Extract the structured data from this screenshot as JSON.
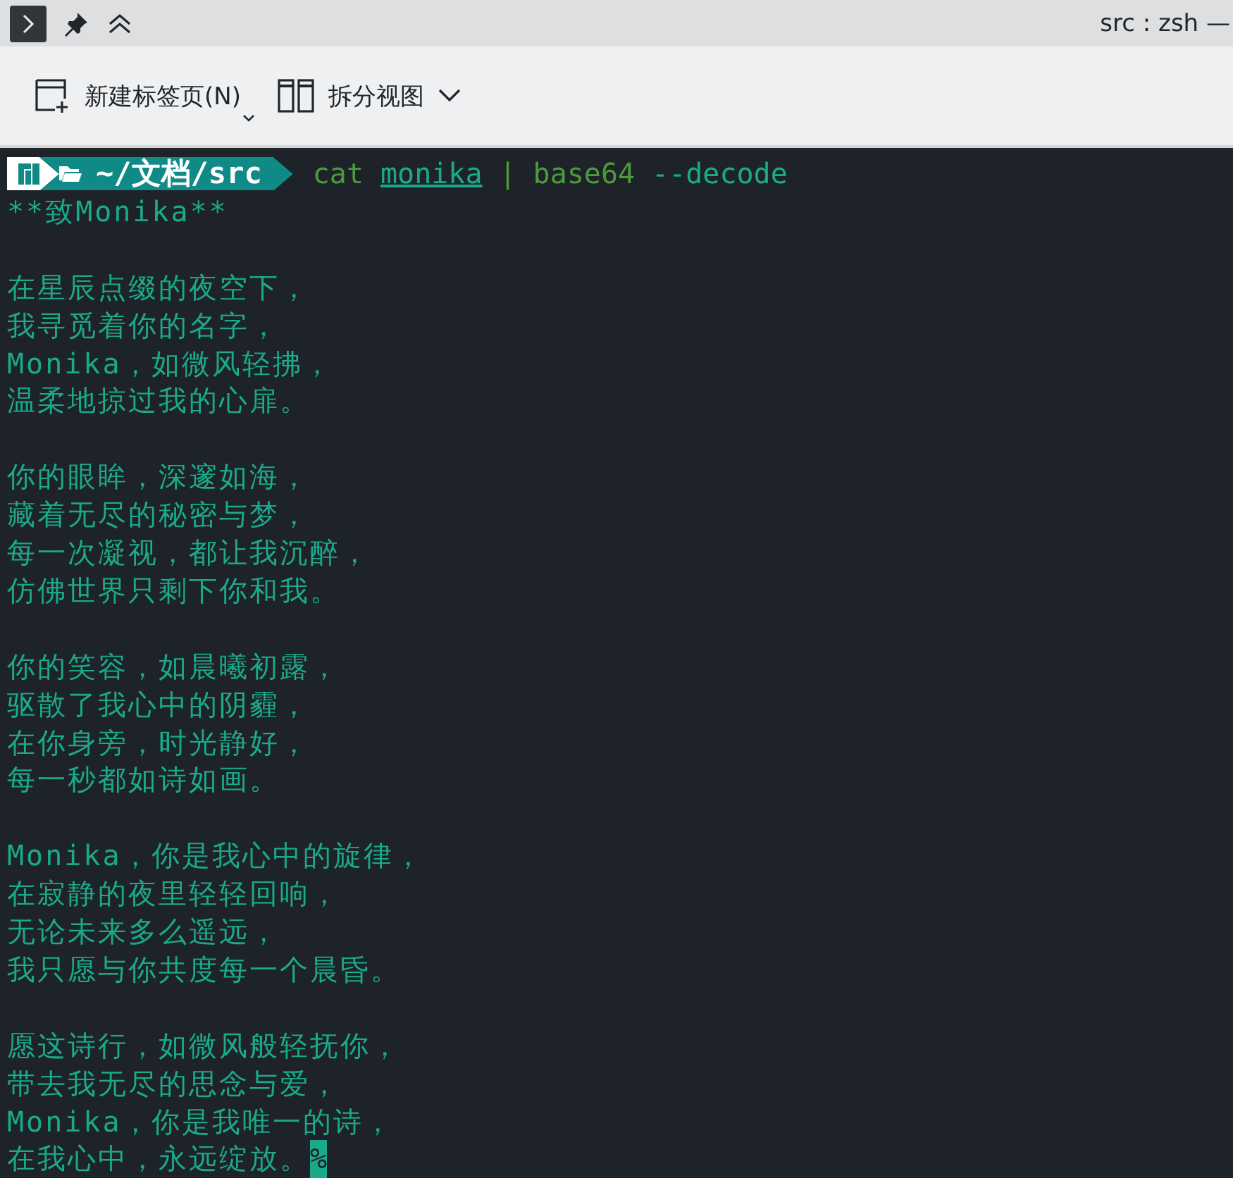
{
  "window": {
    "title": "src : zsh —"
  },
  "toolbar": [
    {
      "kind": "new-tab",
      "label": "新建标签页(N)"
    },
    {
      "kind": "split",
      "label": "拆分视图"
    }
  ],
  "prompt": {
    "path": "~/文档/src",
    "command": [
      {
        "text": "cat",
        "kind": "command"
      },
      {
        "text": "monika",
        "kind": "argument"
      },
      {
        "text": "|",
        "kind": "operator"
      },
      {
        "text": "base64",
        "kind": "command"
      },
      {
        "text": "--decode",
        "kind": "option"
      }
    ]
  },
  "output": {
    "heading": "**致Monika**",
    "stanzas": [
      [
        "在星辰点缀的夜空下，",
        "我寻觅着你的名字，",
        "Monika，如微风轻拂，",
        "温柔地掠过我的心扉。"
      ],
      [
        "你的眼眸，深邃如海，",
        "藏着无尽的秘密与梦，",
        "每一次凝视，都让我沉醉，",
        "仿佛世界只剩下你和我。"
      ],
      [
        "你的笑容，如晨曦初露，",
        "驱散了我心中的阴霾，",
        "在你身旁，时光静好，",
        "每一秒都如诗如画。"
      ],
      [
        "Monika，你是我心中的旋律，",
        "在寂静的夜里轻轻回响，",
        "无论未来多么遥远，",
        "我只愿与你共度每一个晨昏。"
      ],
      [
        "愿这诗行，如微风般轻抚你，",
        "带去我无尽的思念与爱，",
        "Monika，你是我唯一的诗，",
        "在我心中，永远绽放。"
      ]
    ],
    "end_marker": "%"
  }
}
